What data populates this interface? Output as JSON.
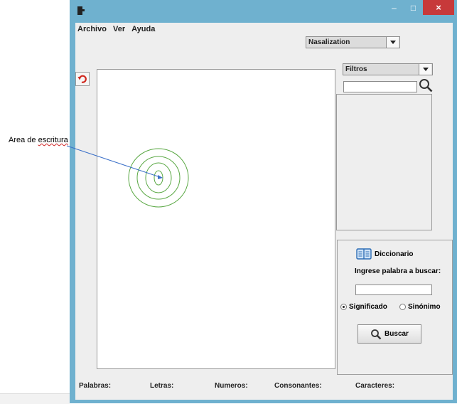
{
  "annotation": {
    "label_part1": "Area de ",
    "label_part2": "escritura"
  },
  "menu": {
    "archivo": "Archivo",
    "ver": "Ver",
    "ayuda": "Ayuda"
  },
  "window_controls": {
    "minimize": "–",
    "maximize": "□",
    "close": "×"
  },
  "nasalization_select": {
    "value": "Nasalization"
  },
  "filter_select": {
    "value": "Filtros"
  },
  "dictionary": {
    "title": "Diccionario",
    "prompt": "Ingrese palabra a buscar:",
    "radio_signif": "Significado",
    "radio_sinon": "Sinónimo",
    "search_button": "Buscar",
    "selected_mode": "Significado"
  },
  "status": {
    "palabras": "Palabras:",
    "letras": "Letras:",
    "numeros": "Numeros:",
    "consonantes": "Consonantes:",
    "caracteres": "Caracteres:"
  },
  "colors": {
    "title_bar": "#6fb1cf",
    "close_button": "#c7393a",
    "spiral": "#5aa844",
    "pointer_line": "#3a6fc8"
  },
  "icons": {
    "app": "java-app-icon",
    "undo": "undo-arrow-icon",
    "search": "magnifier-icon",
    "dictionary": "open-book-icon"
  }
}
